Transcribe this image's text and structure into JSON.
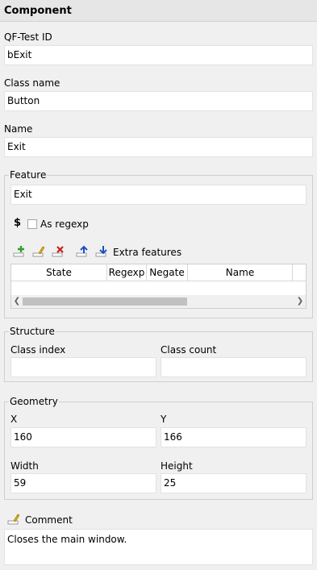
{
  "header": {
    "title": "Component"
  },
  "fields": {
    "qf_id": {
      "label": "QF-Test ID",
      "value": "bExit"
    },
    "class_name": {
      "label": "Class name",
      "value": "Button"
    },
    "name": {
      "label": "Name",
      "value": "Exit"
    }
  },
  "feature": {
    "title": "Feature",
    "value": "Exit",
    "regexp_symbol": "$",
    "regexp_label": "As regexp",
    "extra_label": "Extra features",
    "columns": [
      "State",
      "Regexp",
      "Negate",
      "Name"
    ]
  },
  "structure": {
    "title": "Structure",
    "class_index_label": "Class index",
    "class_index_value": "",
    "class_count_label": "Class count",
    "class_count_value": ""
  },
  "geometry": {
    "title": "Geometry",
    "x_label": "X",
    "x_value": "160",
    "y_label": "Y",
    "y_value": "166",
    "width_label": "Width",
    "width_value": "59",
    "height_label": "Height",
    "height_value": "25"
  },
  "comment": {
    "label": "Comment",
    "value": "Closes the main window."
  },
  "colors": {
    "add": "#2ea02e",
    "remove": "#c81e1e",
    "arrow": "#1f4fbf",
    "edit": "#e0b000"
  }
}
